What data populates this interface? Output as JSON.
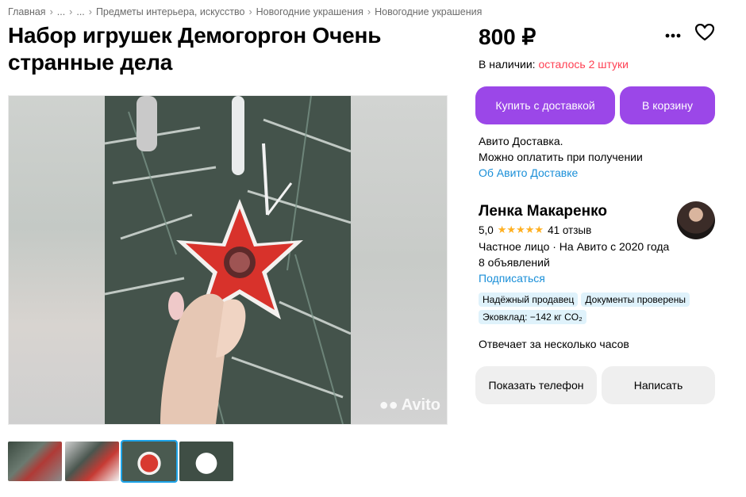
{
  "breadcrumb": [
    "Главная",
    "...",
    "...",
    "Предметы интерьера, искусство",
    "Новогодние украшения",
    "Новогодние украшения"
  ],
  "title": "Набор игрушек Демогоргон Очень странные дела",
  "watermark": "Avito",
  "price": "800 ₽",
  "stock": {
    "label": "В наличии:",
    "left": "осталось 2 штуки"
  },
  "buttons": {
    "buy_delivery": "Купить с доставкой",
    "to_cart": "В корзину",
    "show_phone": "Показать телефон",
    "write": "Написать"
  },
  "delivery": {
    "line1": "Авито Доставка.",
    "line2": "Можно оплатить при получении",
    "link": "Об Авито Доставке"
  },
  "seller": {
    "name": "Ленка Макаренко",
    "rating": "5,0",
    "stars": "★★★★★",
    "reviews": "41 отзыв",
    "type": "Частное лицо · На Авито с 2020 года",
    "listings": "8 объявлений",
    "subscribe": "Подписаться",
    "badges": [
      "Надёжный продавец",
      "Документы проверены",
      "Эковклад: −142 кг CO₂"
    ],
    "reply_time": "Отвечает за несколько часов"
  },
  "colors": {
    "accent": "#9b47e8",
    "link": "#1a8fd8",
    "stock_warning": "#ff4053",
    "badge_bg": "#dff2fb"
  },
  "icons": [
    "more-dots-icon",
    "heart-icon",
    "avito-watermark-icon"
  ]
}
